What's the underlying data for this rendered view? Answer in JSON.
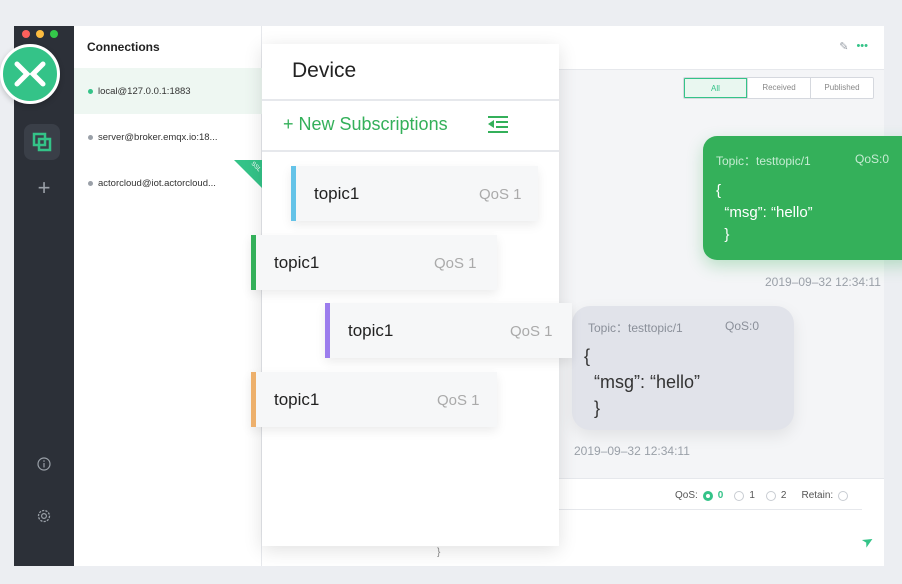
{
  "sidebar": {
    "traffic_colors": [
      "#fc605c",
      "#fdbc40",
      "#34c84a"
    ],
    "logo_icon": "mqttx-logo",
    "icons": [
      "connections-icon",
      "plus-icon",
      "info-icon",
      "settings-icon"
    ]
  },
  "connections": {
    "header": "Connections",
    "items": [
      {
        "label": "local@127.0.0.1:1883",
        "status_color": "#34c388",
        "selected": true
      },
      {
        "label": "server@broker.emqx.io:18...",
        "status_color": "#9aa0a8"
      },
      {
        "label": "actorcloud@iot.actorcloud...",
        "status_color": "#9aa0a8",
        "ssl": "SSL"
      }
    ]
  },
  "filter": {
    "all": "All",
    "received": "Received",
    "published": "Published"
  },
  "messages": [
    {
      "direction": "published",
      "topic": "Topic：testtopic/1",
      "qos": "QoS:0",
      "payload": "{\n  “msg”: “hello”\n  }",
      "time": "2019–09–32  12:34:11"
    },
    {
      "direction": "received",
      "topic": "Topic：testtopic/1",
      "qos": "QoS:0",
      "payload": "{\n  “msg”: “hello”\n  }",
      "time": "2019–09–32  12:34:11"
    }
  ],
  "composer": {
    "qos_label": "QoS:",
    "qos_options": [
      "0",
      "1",
      "2"
    ],
    "qos_selected": "0",
    "retain_label": "Retain:",
    "brace": "}"
  },
  "subscriptions": {
    "title": "Device",
    "new_label": "+ New Subscriptions",
    "items": [
      {
        "topic": "topic1",
        "qos": "QoS 1",
        "color": "#64c3e8"
      },
      {
        "topic": "topic1",
        "qos": "QoS 1",
        "color": "#34b05a"
      },
      {
        "topic": "topic1",
        "qos": "QoS 1",
        "color": "#9c7ded"
      },
      {
        "topic": "topic1",
        "qos": "QoS 1",
        "color": "#edb06c"
      }
    ]
  },
  "accent": "#34c388"
}
